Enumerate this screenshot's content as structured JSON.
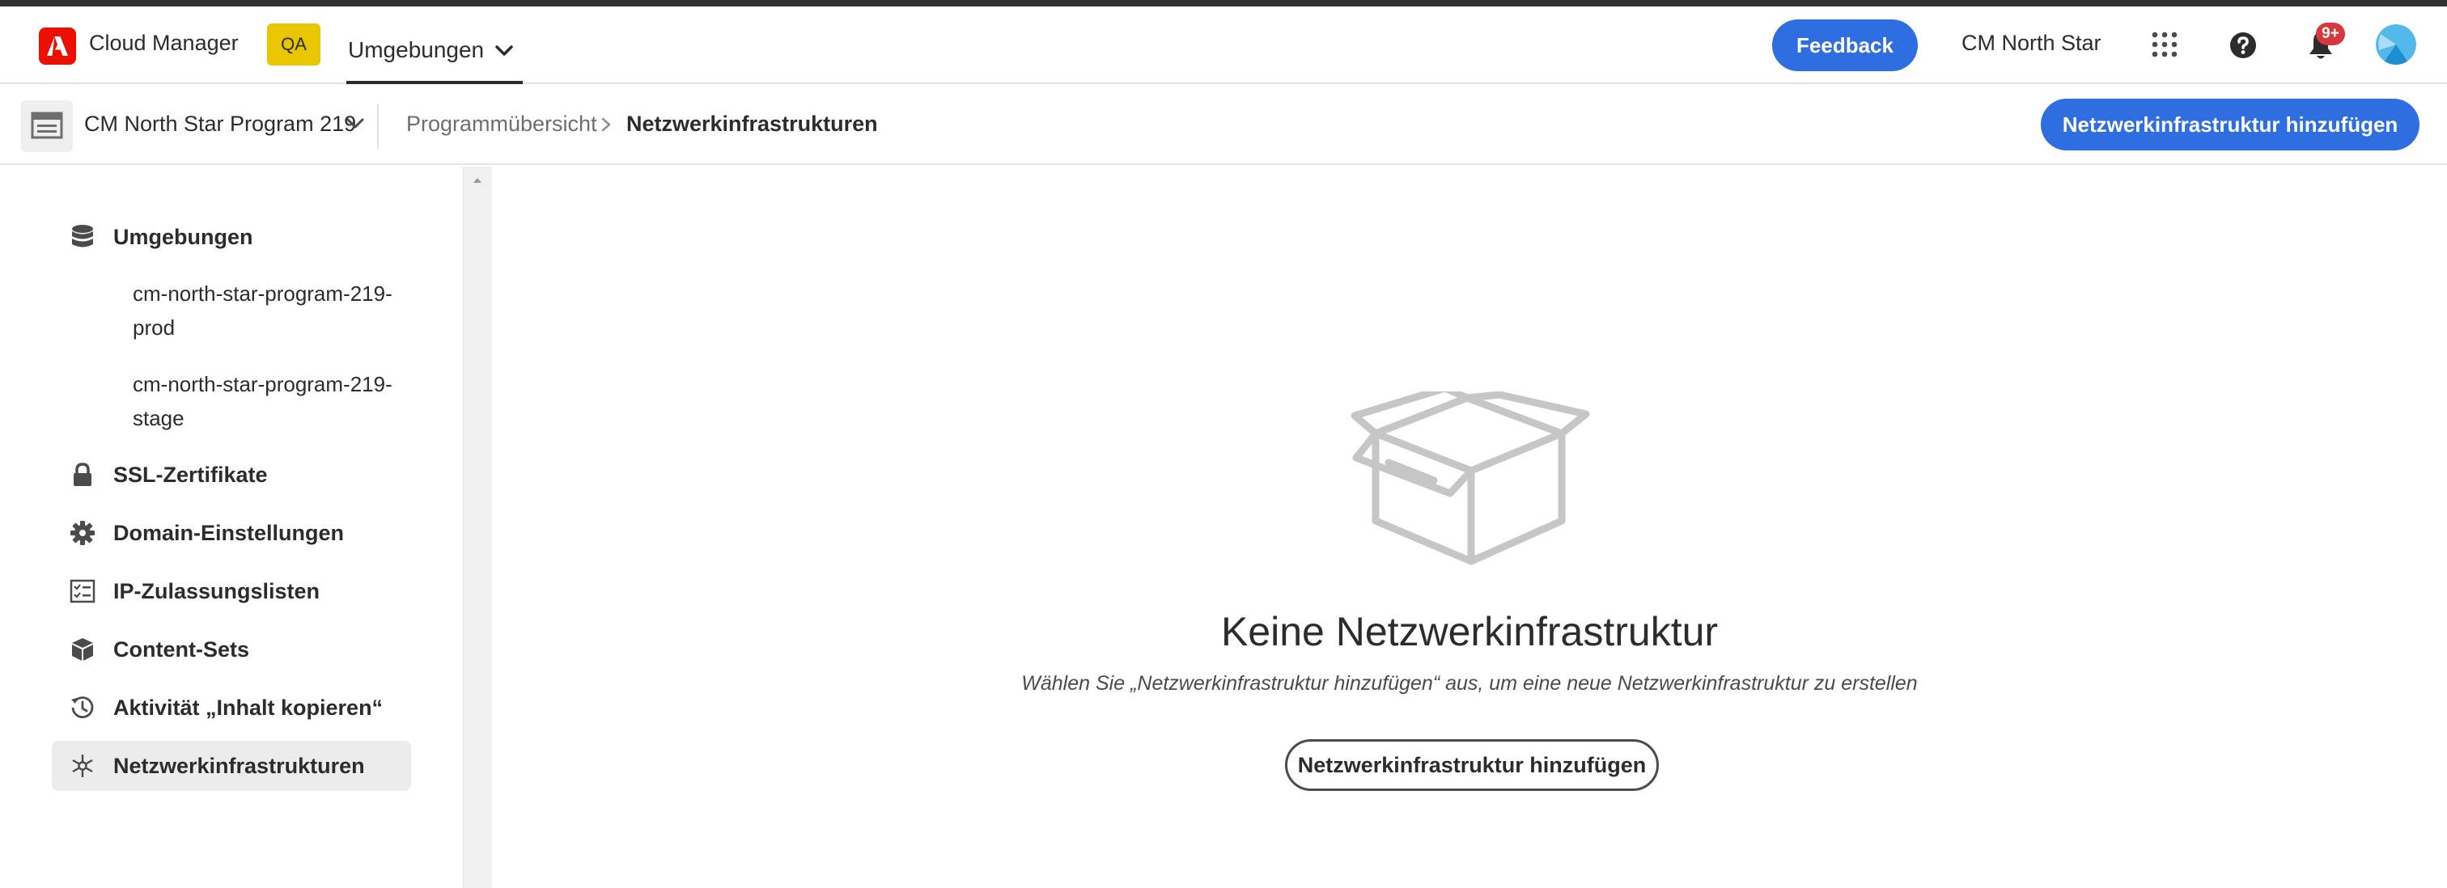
{
  "header": {
    "app_title": "Cloud Manager",
    "badge": "QA",
    "env_label": "Umgebungen",
    "feedback_label": "Feedback",
    "user_name": "CM North Star",
    "notification_count": "9+",
    "icons": {
      "logo": "adobe-logo-icon",
      "apps": "apps-grid-icon",
      "help": "help-icon",
      "bell": "bell-icon",
      "avatar": "avatar"
    },
    "colors": {
      "accent": "#2f6ee0",
      "logo": "#eb1000",
      "badge": "#e8c600",
      "notification": "#d7373f"
    }
  },
  "subheader": {
    "program_name": "CM North Star Program 219",
    "breadcrumb": [
      "Programmübersicht",
      "Netzwerkinfrastrukturen"
    ],
    "add_button": "Netzwerkinfrastruktur hinzufügen"
  },
  "sidebar": {
    "items": [
      {
        "label": "Umgebungen",
        "icon": "database-icon"
      },
      {
        "label": "SSL-Zertifikate",
        "icon": "lock-icon"
      },
      {
        "label": "Domain-Einstellungen",
        "icon": "gear-icon"
      },
      {
        "label": "IP-Zulassungslisten",
        "icon": "checklist-icon"
      },
      {
        "label": "Content-Sets",
        "icon": "boxes-icon"
      },
      {
        "label": "Aktivität „Inhalt kopieren“",
        "icon": "history-icon"
      },
      {
        "label": "Netzwerkinfrastrukturen",
        "icon": "network-icon",
        "selected": true
      }
    ],
    "sub_items": [
      {
        "line1": "cm-north-star-program-219-",
        "line2": "prod"
      },
      {
        "line1": "cm-north-star-program-219-",
        "line2": "stage"
      }
    ]
  },
  "main": {
    "empty_title": "Keine Netzwerkinfrastruktur",
    "empty_description": "Wählen Sie „Netzwerkinfrastruktur hinzufügen“ aus, um eine neue Netzwerkinfrastruktur zu erstellen",
    "add_button": "Netzwerkinfrastruktur hinzufügen",
    "illustration": "empty-box-icon"
  }
}
